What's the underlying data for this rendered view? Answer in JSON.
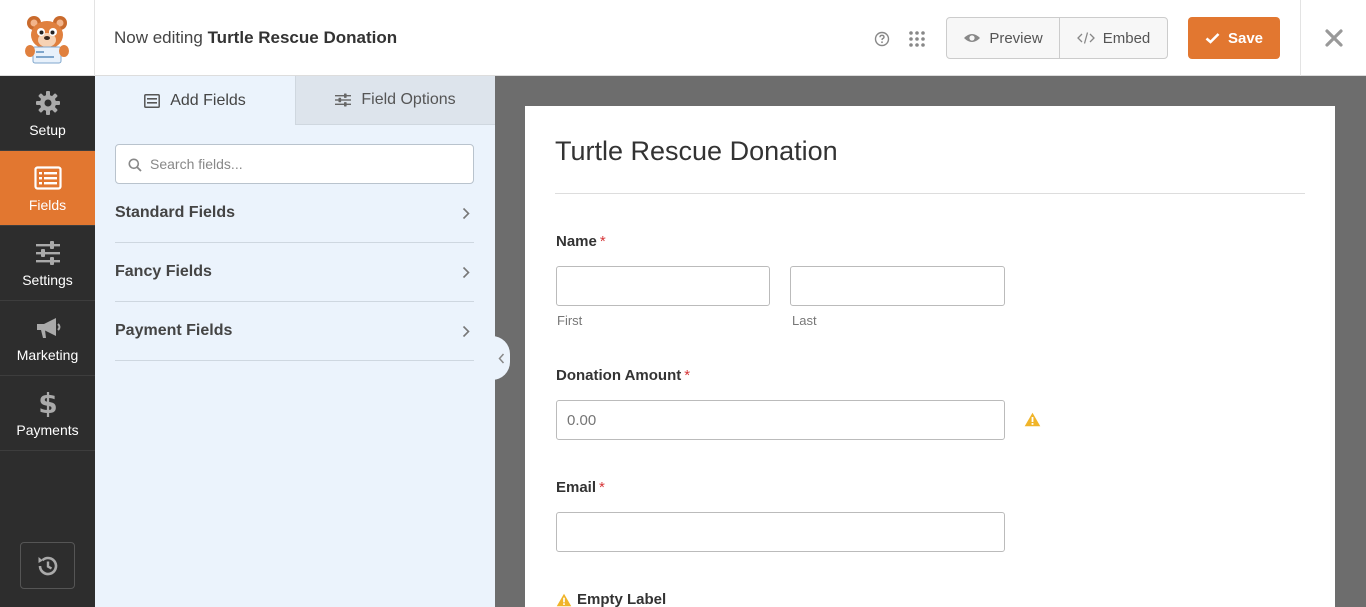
{
  "header": {
    "editing_prefix": "Now editing",
    "form_name": "Turtle Rescue Donation",
    "preview_label": "Preview",
    "embed_label": "Embed",
    "save_label": "Save"
  },
  "nav": {
    "items": [
      {
        "label": "Setup",
        "icon": "gear-icon"
      },
      {
        "label": "Fields",
        "icon": "fields-icon",
        "active": true
      },
      {
        "label": "Settings",
        "icon": "sliders-icon"
      },
      {
        "label": "Marketing",
        "icon": "megaphone-icon"
      },
      {
        "label": "Payments",
        "icon": "dollar-icon"
      }
    ]
  },
  "panel": {
    "tabs": [
      {
        "label": "Add Fields",
        "active": true
      },
      {
        "label": "Field Options",
        "active": false
      }
    ],
    "search": {
      "placeholder": "Search fields..."
    },
    "groups": [
      {
        "label": "Standard Fields"
      },
      {
        "label": "Fancy Fields"
      },
      {
        "label": "Payment Fields"
      }
    ]
  },
  "form": {
    "title": "Turtle Rescue Donation",
    "fields": {
      "name": {
        "label": "Name",
        "required": "*",
        "first_sub": "First",
        "last_sub": "Last"
      },
      "donation": {
        "label": "Donation Amount",
        "required": "*",
        "placeholder": "0.00"
      },
      "email": {
        "label": "Email",
        "required": "*"
      },
      "empty": {
        "label": "Empty Label"
      }
    }
  },
  "colors": {
    "accent": "#e27730",
    "sidebar": "#2d2d2d",
    "panel": "#ebf3fc",
    "warning": "#f0b429",
    "required": "#d63638"
  }
}
